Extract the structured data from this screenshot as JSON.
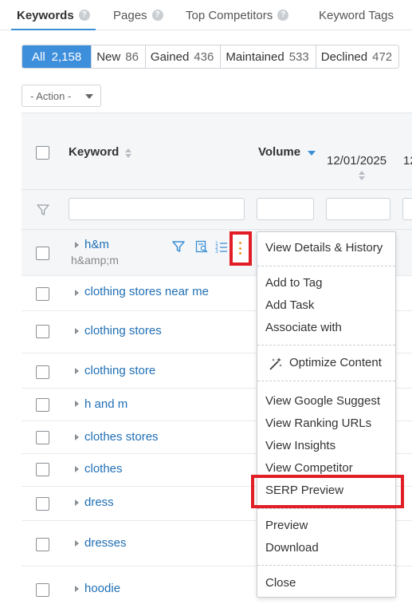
{
  "tabs": [
    {
      "label": "Keywords",
      "active": true
    },
    {
      "label": "Pages",
      "active": false
    },
    {
      "label": "Top Competitors",
      "active": false
    },
    {
      "label": "Keyword Tags",
      "active": false
    }
  ],
  "filters": [
    {
      "label": "All",
      "count": "2,158",
      "active": true
    },
    {
      "label": "New",
      "count": "86"
    },
    {
      "label": "Gained",
      "count": "436"
    },
    {
      "label": "Maintained",
      "count": "533"
    },
    {
      "label": "Declined",
      "count": "472"
    }
  ],
  "action_select": {
    "value": "- Action -"
  },
  "table": {
    "columns": {
      "keyword": "Keyword",
      "volume": "Volume",
      "date1": "12/01/2025",
      "date2_partial": "12"
    },
    "rows": [
      {
        "keyword": "h&m",
        "sub": "h&amp;m"
      },
      {
        "keyword": "clothing stores near me"
      },
      {
        "keyword": "clothing stores"
      },
      {
        "keyword": "clothing store"
      },
      {
        "keyword": "h and m"
      },
      {
        "keyword": "clothes stores"
      },
      {
        "keyword": "clothes"
      },
      {
        "keyword": "dress"
      },
      {
        "keyword": "dresses"
      },
      {
        "keyword": "hoodie"
      }
    ]
  },
  "context_menu": {
    "items": {
      "details": "View Details & History",
      "add_tag": "Add to Tag",
      "add_task": "Add Task",
      "associate": "Associate with",
      "optimize": "Optimize Content",
      "suggest": "View Google Suggest",
      "ranking_urls": "View Ranking URLs",
      "insights": "View Insights",
      "competitor": "View Competitor",
      "serp": "SERP Preview",
      "preview": "Preview",
      "download": "Download",
      "close": "Close"
    }
  },
  "colors": {
    "accent": "#3d8fdb",
    "link": "#1f6fb5",
    "highlight": "#e11d25",
    "kebab": "#e89a2b"
  }
}
